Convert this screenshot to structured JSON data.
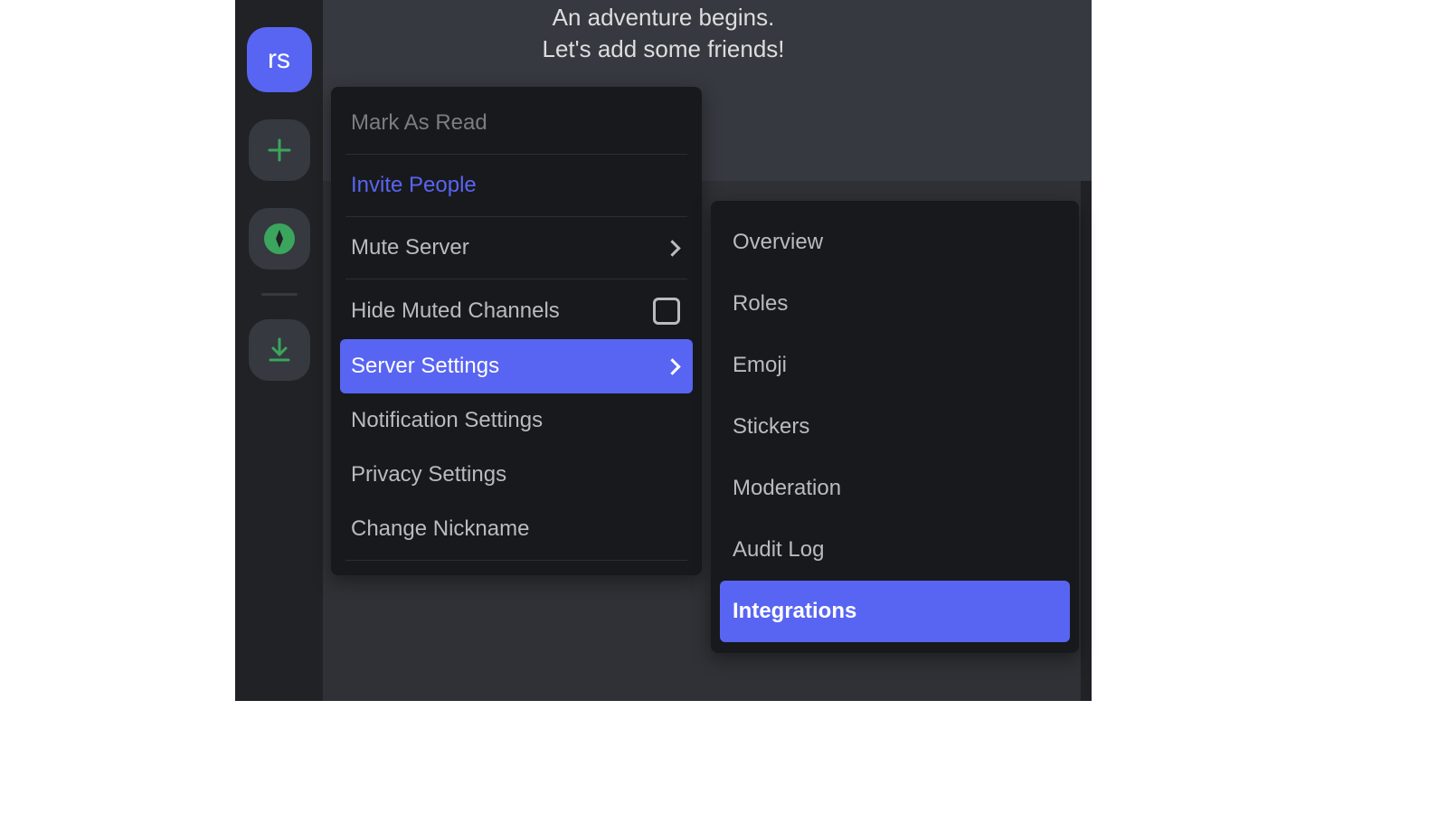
{
  "banner": {
    "line1": "An adventure begins.",
    "line2": "Let's add some friends!"
  },
  "rail": {
    "server_initials": "rs"
  },
  "context_menu": {
    "mark_as_read": "Mark As Read",
    "invite_people": "Invite People",
    "mute_server": "Mute Server",
    "hide_muted_channels": "Hide Muted Channels",
    "server_settings": "Server Settings",
    "notification_settings": "Notification Settings",
    "privacy_settings": "Privacy Settings",
    "change_nickname": "Change Nickname"
  },
  "server_settings_submenu": {
    "overview": "Overview",
    "roles": "Roles",
    "emoji": "Emoji",
    "stickers": "Stickers",
    "moderation": "Moderation",
    "audit_log": "Audit Log",
    "integrations": "Integrations"
  }
}
